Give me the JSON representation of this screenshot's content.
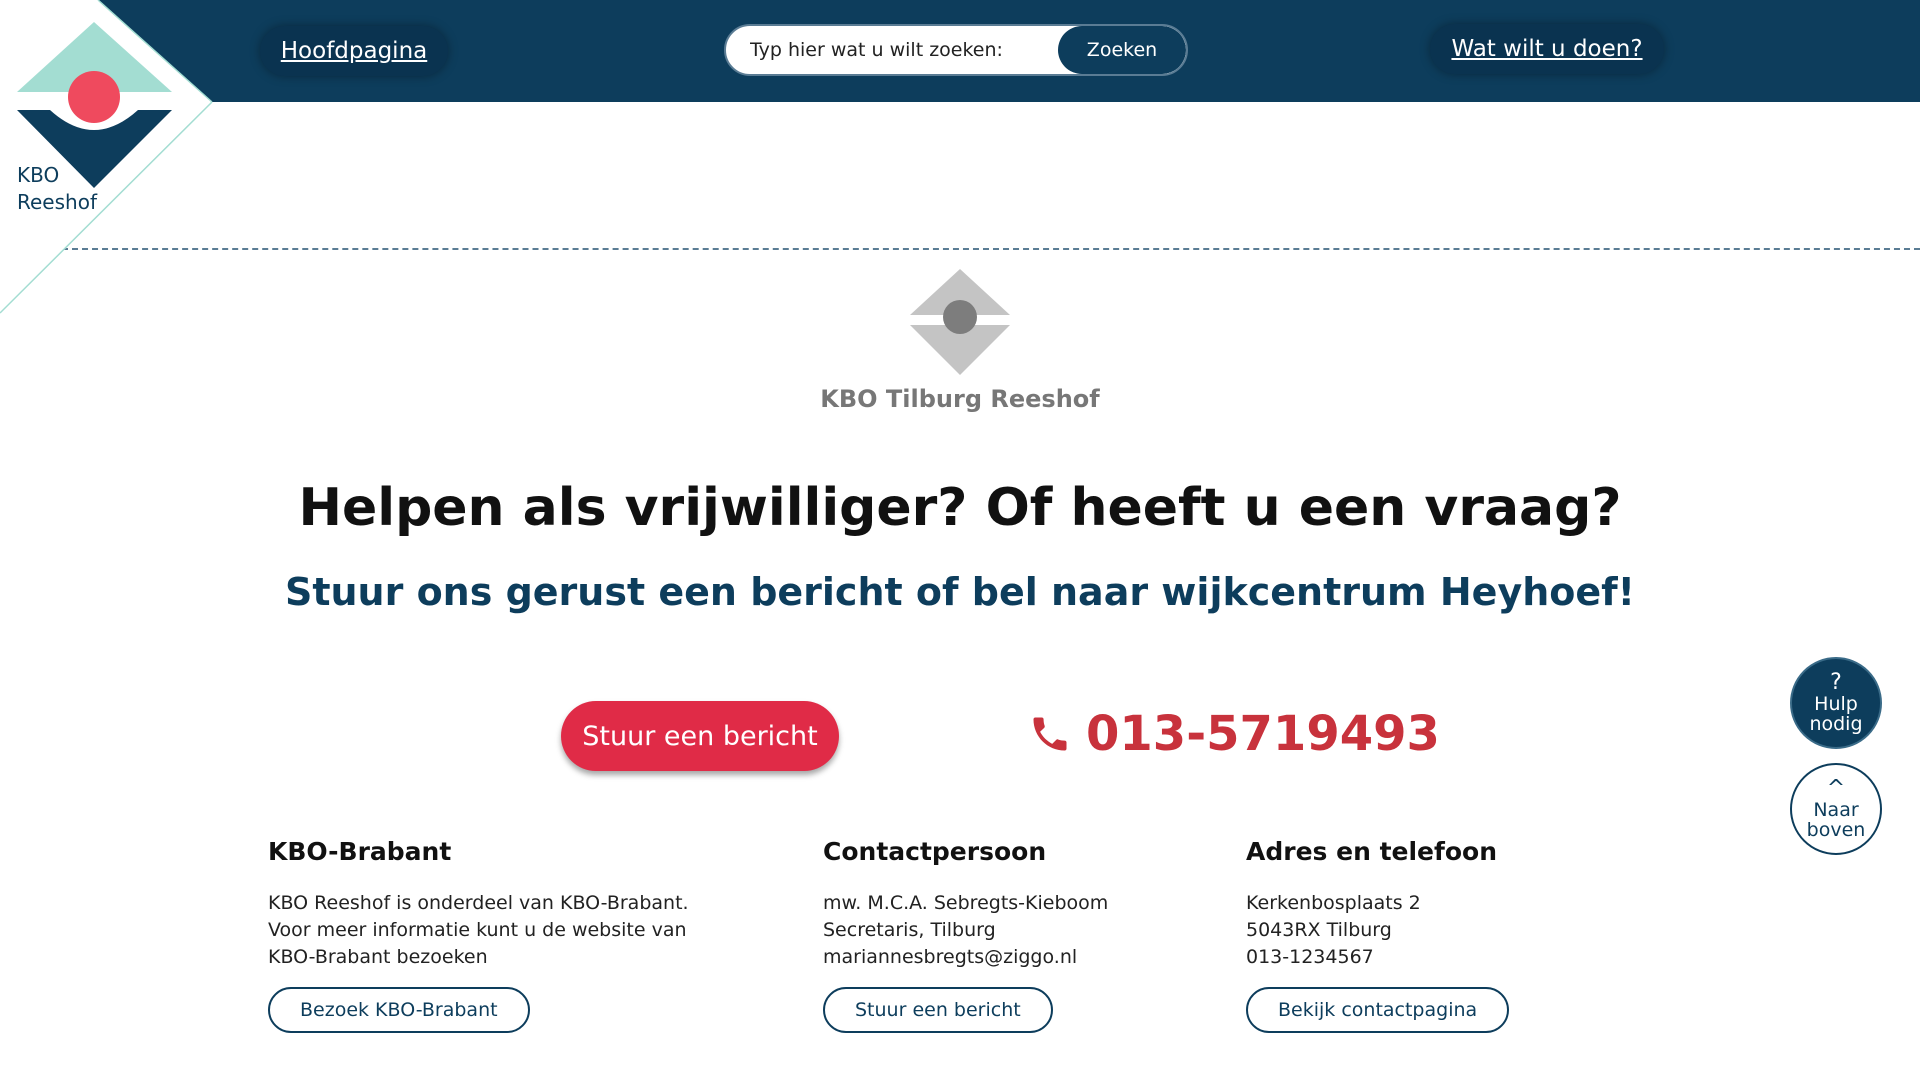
{
  "brand": {
    "logo_line1": "KBO",
    "logo_line2": "Reeshof",
    "colors": {
      "navy": "#0d3d5c",
      "mint": "#a3ddd2",
      "red": "#e02b47",
      "phone_red": "#c8323c",
      "gray": "#777777"
    }
  },
  "nav": {
    "home_label": "Hoofdpagina",
    "what_label": "Wat wilt u doen?"
  },
  "search": {
    "placeholder": "Typ hier wat u wilt zoeken:",
    "button_label": "Zoeken",
    "icon": "search-icon"
  },
  "org": {
    "name": "KBO Tilburg Reeshof"
  },
  "hero": {
    "headline": "Helpen als vrijwilliger? Of heeft u een vraag?",
    "subheadline": "Stuur ons gerust een bericht of bel naar wijkcentrum Heyhoef!",
    "cta_label": "Stuur een bericht",
    "phone_number": "013-5719493",
    "phone_icon": "phone-icon"
  },
  "footer": {
    "columns": [
      {
        "title": "KBO-Brabant",
        "lines": [
          "KBO Reeshof is onderdeel van KBO-Brabant.",
          "Voor meer informatie kunt u de website van",
          "KBO-Brabant bezoeken"
        ],
        "button": "Bezoek KBO-Brabant"
      },
      {
        "title": "Contactpersoon",
        "lines": [
          "mw. M.C.A. Sebregts-Kieboom",
          "Secretaris, Tilburg",
          "mariannesbregts@ziggo.nl"
        ],
        "button": "Stuur een bericht"
      },
      {
        "title": "Adres en telefoon",
        "lines": [
          "Kerkenbosplaats 2",
          "5043RX Tilburg",
          "013-1234567"
        ],
        "button": "Bekijk contactpagina"
      }
    ]
  },
  "floating": {
    "help_icon": "?",
    "help_line1": "Hulp",
    "help_line2": "nodig",
    "top_icon": "^",
    "top_line1": "Naar",
    "top_line2": "boven"
  }
}
